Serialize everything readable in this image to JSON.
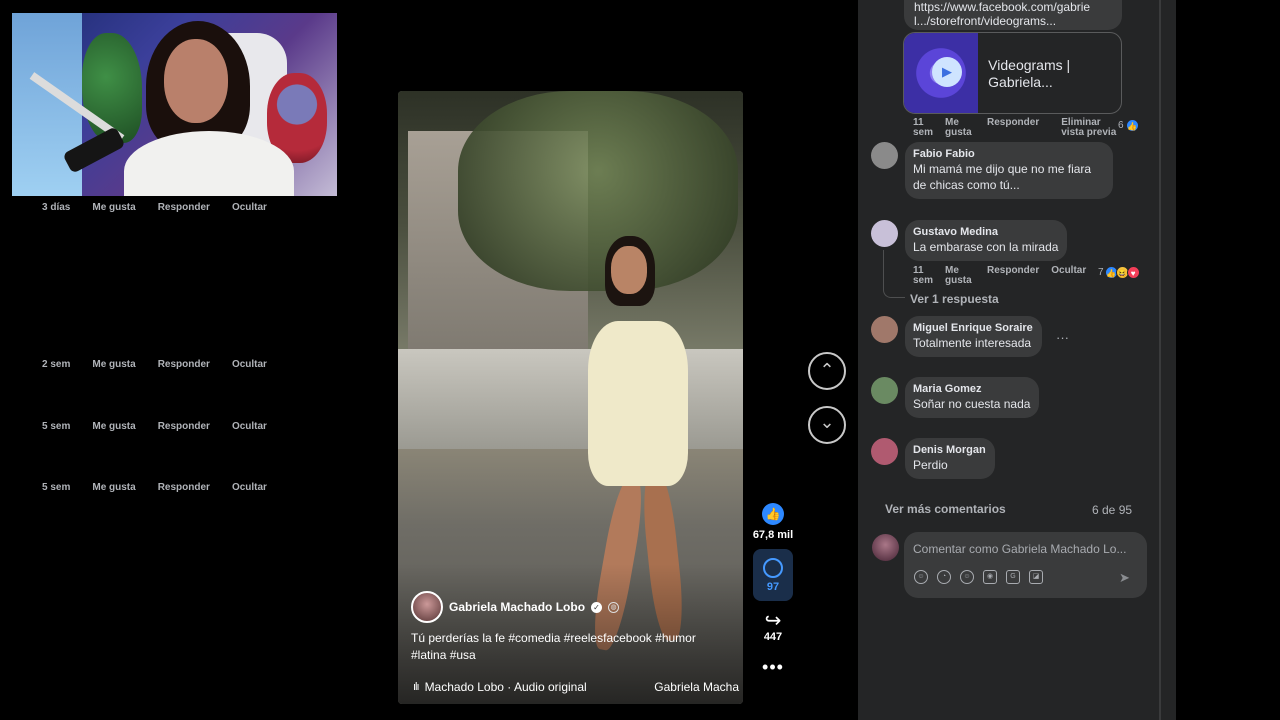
{
  "reel": {
    "author": "Gabriela Machado Lobo",
    "caption": "Tú perderías la fe  #comedia #reelesfacebook #humor #latina #usa",
    "audio": "Machado Lobo · Audio original",
    "audio_right": "Gabriela Macha",
    "likes": "67,8 mil",
    "comments": "97",
    "shares": "447"
  },
  "link": {
    "url": "https://www.facebook.com/gabrie l.../storefront/videograms...",
    "preview_title": "Videograms | Gabriela...",
    "meta": {
      "time": "11 sem",
      "like": "Me gusta",
      "reply": "Responder",
      "remove": "Eliminar vista previa",
      "reactions": "6"
    }
  },
  "comments": [
    {
      "name": "Fabio Fabio",
      "text": "Mi mamá me dijo que no me fiara de chicas como tú...",
      "time": "3 días",
      "like": "Me gusta",
      "reply": "Responder",
      "hide": "Ocultar",
      "avatar_color": "#8a8a8a"
    },
    {
      "name": "Gustavo Medina",
      "text": "La embarase con la mirada",
      "time": "11 sem",
      "like": "Me gusta",
      "reply": "Responder",
      "hide": "Ocultar",
      "reactions": "7",
      "replies": "Ver 1 respuesta",
      "avatar_color": "#c8c0d8"
    },
    {
      "name": "Miguel Enrique Soraire",
      "text": "Totalmente interesada",
      "time": "2 sem",
      "like": "Me gusta",
      "reply": "Responder",
      "hide": "Ocultar",
      "avatar_color": "#a0786a"
    },
    {
      "name": "Maria Gomez",
      "text": "Soñar no cuesta nada",
      "time": "5 sem",
      "like": "Me gusta",
      "reply": "Responder",
      "hide": "Ocultar",
      "avatar_color": "#6a8a62"
    },
    {
      "name": "Denis Morgan",
      "text": "Perdio",
      "time": "5 sem",
      "like": "Me gusta",
      "reply": "Responder",
      "hide": "Ocultar",
      "avatar_color": "#b05a70"
    }
  ],
  "more_comments": "Ver más comentarios",
  "page_count": "6 de 95",
  "composer": {
    "placeholder": "Comentar como Gabriela Machado Lo..."
  },
  "colors": {
    "panel": "#242526",
    "bubble": "#3a3b3c",
    "accent": "#2d88ff"
  },
  "icons": [
    "thumbs-up-icon",
    "comment-icon",
    "share-icon",
    "more-icon",
    "chevron-up-icon",
    "chevron-down-icon",
    "send-icon"
  ]
}
